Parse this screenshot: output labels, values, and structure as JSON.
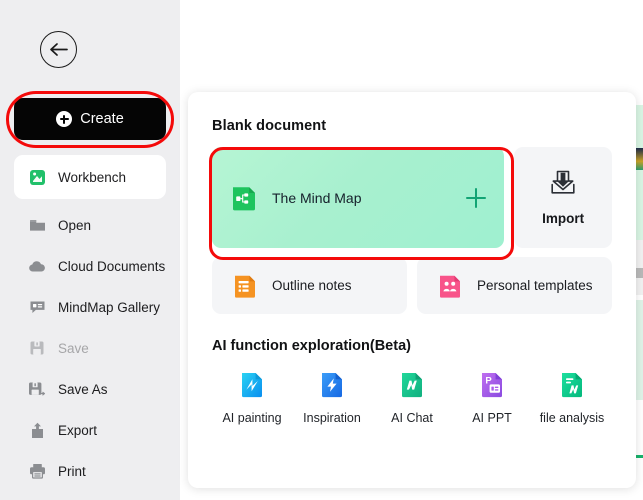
{
  "sidebar": {
    "back_button": "back-arrow",
    "create": {
      "label": "Create",
      "icon": "plus-circle-icon"
    },
    "items": [
      {
        "label": "Workbench",
        "icon": "workbench-icon",
        "active": true,
        "disabled": false
      },
      {
        "label": "Open",
        "icon": "folder-icon",
        "active": false,
        "disabled": false
      },
      {
        "label": "Cloud Documents",
        "icon": "cloud-icon",
        "active": false,
        "disabled": false
      },
      {
        "label": "MindMap Gallery",
        "icon": "gallery-icon",
        "active": false,
        "disabled": false
      },
      {
        "label": "Save",
        "icon": "save-icon",
        "active": false,
        "disabled": true
      },
      {
        "label": "Save As",
        "icon": "save-as-icon",
        "active": false,
        "disabled": false
      },
      {
        "label": "Export",
        "icon": "export-upload-icon",
        "active": false,
        "disabled": false
      },
      {
        "label": "Print",
        "icon": "printer-icon",
        "active": false,
        "disabled": false
      }
    ]
  },
  "main": {
    "blank_document": {
      "title": "Blank document",
      "mind_map": {
        "label": "The Mind Map",
        "icon": "mindmap-node-icon",
        "plus": "plus-icon"
      },
      "import": {
        "label": "Import",
        "icon": "import-tray-icon"
      },
      "outline": {
        "label": "Outline notes",
        "icon": "outline-notes-icon"
      },
      "templates": {
        "label": "Personal templates",
        "icon": "personal-templates-icon"
      }
    },
    "ai_section": {
      "title": "AI function exploration(Beta)",
      "items": [
        {
          "label": "AI painting",
          "icon": "ai-painting-icon"
        },
        {
          "label": "Inspiration",
          "icon": "inspiration-bolt-icon"
        },
        {
          "label": "AI Chat",
          "icon": "ai-chat-icon"
        },
        {
          "label": "AI PPT",
          "icon": "ai-ppt-icon"
        },
        {
          "label": "file analysis",
          "icon": "file-analysis-icon"
        }
      ]
    }
  },
  "annotations": {
    "highlight_color": "#f40a0a",
    "targets": [
      "Create",
      "The Mind Map"
    ]
  },
  "colors": {
    "sidebar_bg": "#eeeef0",
    "create_bg": "#050505",
    "mindmap_card": "#a8f0cf",
    "card_bg": "#f4f5f7",
    "accent_green": "#12a474"
  }
}
